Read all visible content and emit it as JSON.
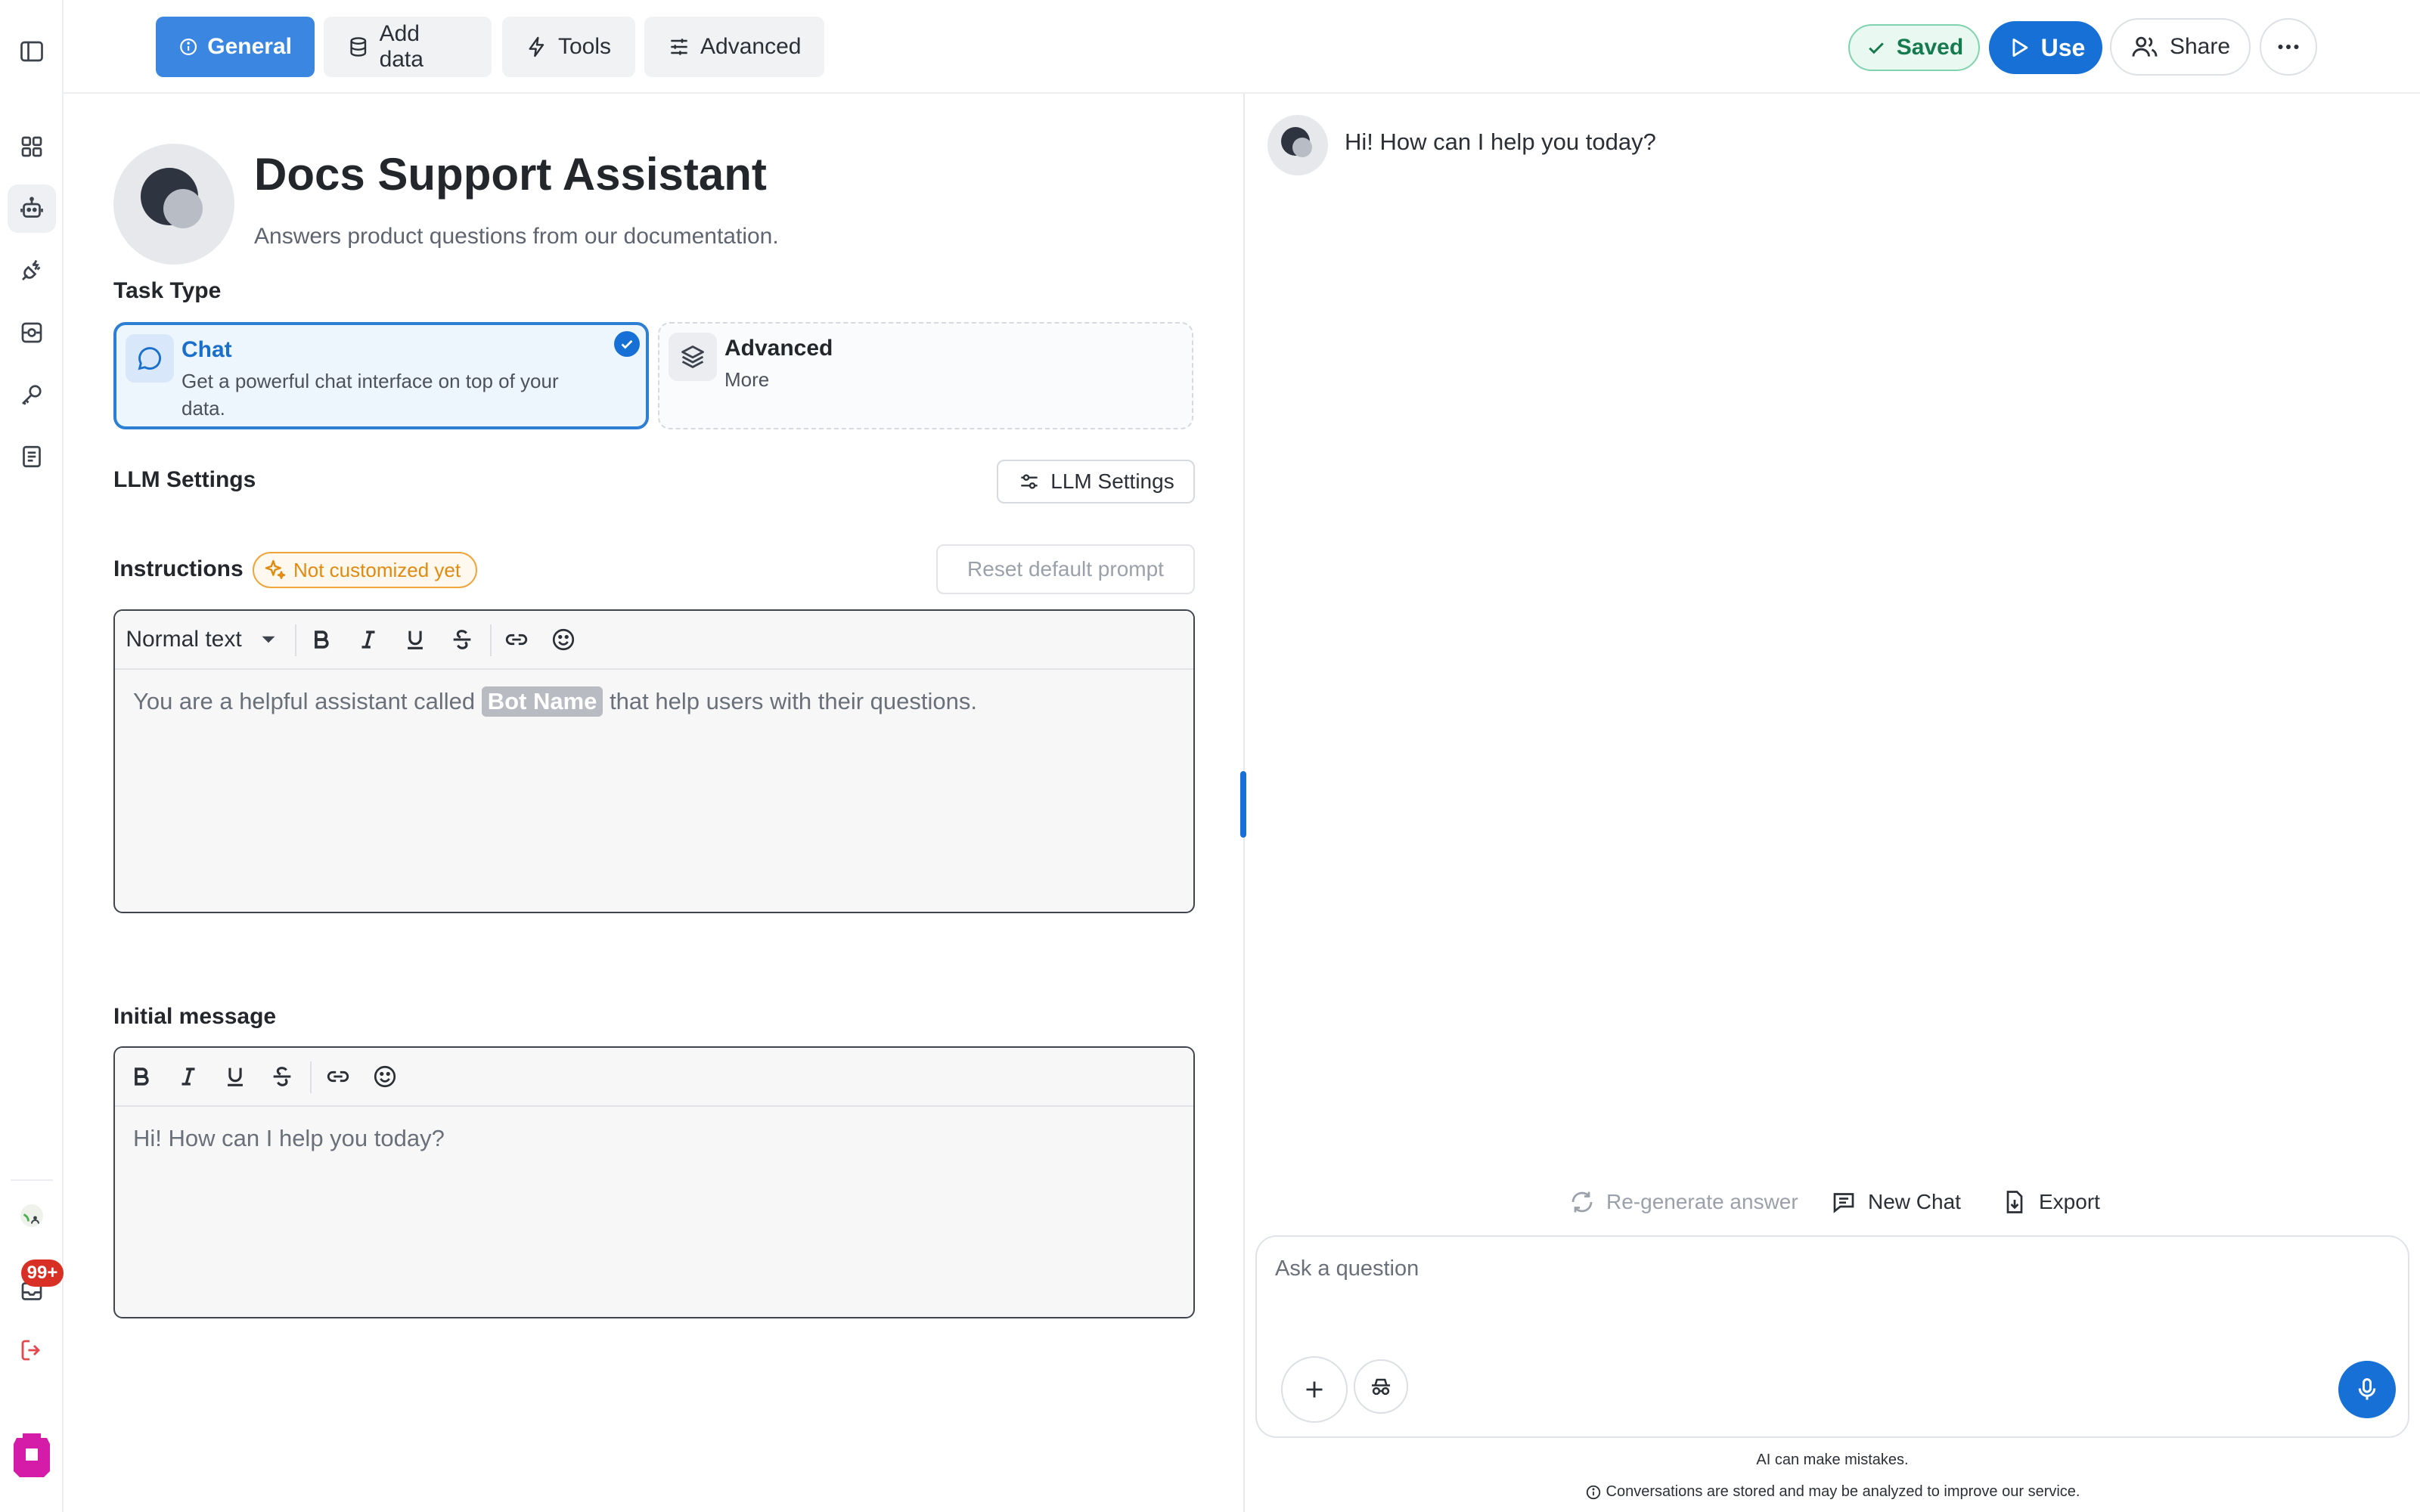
{
  "topbar": {
    "tabs": [
      {
        "label": "General",
        "icon": "info-icon",
        "active": true
      },
      {
        "label": "Add data",
        "icon": "database-icon",
        "active": false
      },
      {
        "label": "Tools",
        "icon": "bolt-icon",
        "active": false
      },
      {
        "label": "Advanced",
        "icon": "sliders-icon",
        "active": false
      }
    ],
    "saved_label": "Saved",
    "use_label": "Use",
    "share_label": "Share"
  },
  "rail": {
    "notifications_badge": "99+"
  },
  "bot": {
    "name": "Docs Support Assistant",
    "description": "Answers product questions from our documentation."
  },
  "task_type": {
    "label": "Task Type",
    "options": [
      {
        "name": "Chat",
        "description": "Get a powerful chat interface on top of your data.",
        "selected": true
      },
      {
        "name": "Advanced",
        "description": "More",
        "selected": false
      }
    ]
  },
  "llm": {
    "label": "LLM Settings",
    "button_label": "LLM Settings"
  },
  "instructions": {
    "label": "Instructions",
    "status_badge": "Not customized yet",
    "reset_label": "Reset default prompt",
    "format": "Normal text",
    "text_before": "You are a helpful assistant called",
    "variable": "Bot Name",
    "text_after": "that help users with their questions."
  },
  "initial_message": {
    "label": "Initial message",
    "text": "Hi! How can I help you today?"
  },
  "chat": {
    "greeting": "Hi! How can I help you today?",
    "regenerate_label": "Re-generate answer",
    "new_chat_label": "New Chat",
    "export_label": "Export",
    "input_placeholder": "Ask a question",
    "disclaimer_1": "AI can make mistakes.",
    "disclaimer_2": "Conversations are stored and may be analyzed to improve our service."
  },
  "colors": {
    "accent": "#1670d6",
    "tab_active": "#3a86e0",
    "saved": "#157a4d",
    "warning": "#e08a0f",
    "badge": "#d93025"
  }
}
